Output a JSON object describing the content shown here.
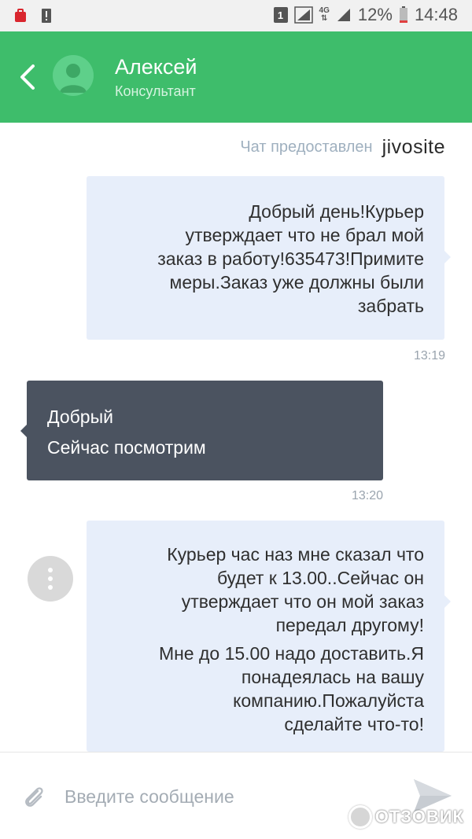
{
  "statusbar": {
    "sim_number": "1",
    "network": "4G",
    "battery": "12%",
    "time": "14:48"
  },
  "header": {
    "agent_name": "Алексей",
    "agent_role": "Консультант"
  },
  "provider": {
    "label": "Чат предоставлен",
    "brand_prefix": "jivo",
    "brand_suffix": "site"
  },
  "messages": [
    {
      "direction": "out",
      "lines": [
        "Добрый день!Курьер",
        "утверждает что не брал мой",
        "заказ в работу!635473!Примите",
        "меры.Заказ уже должны были",
        "забрать"
      ],
      "time": "13:19"
    },
    {
      "direction": "in",
      "lines": [
        "Добрый",
        "Сейчас посмотрим"
      ],
      "time": "13:20"
    },
    {
      "direction": "out",
      "paragraphs": [
        [
          "Курьер час наз мне сказал что",
          "будет к 13.00..Сейчас он",
          "утверждает что он мой заказ",
          "передал другому!"
        ],
        [
          "Мне до 15.00 надо доставить.Я",
          "понадеялась на вашу",
          "компанию.Пожалуйста",
          "сделайте что-то!"
        ]
      ]
    }
  ],
  "composer": {
    "placeholder": "Введите сообщение"
  },
  "watermark": {
    "text": "ОТЗОВИК"
  },
  "icons": {
    "back": "chevron-left-icon",
    "avatar": "person-icon",
    "attach": "paperclip-icon",
    "send": "send-icon",
    "menu": "more-vertical-icon"
  },
  "colors": {
    "header": "#3ebd6b",
    "incoming_bubble": "#4b5360",
    "outgoing_bubble": "#e7eefa"
  }
}
